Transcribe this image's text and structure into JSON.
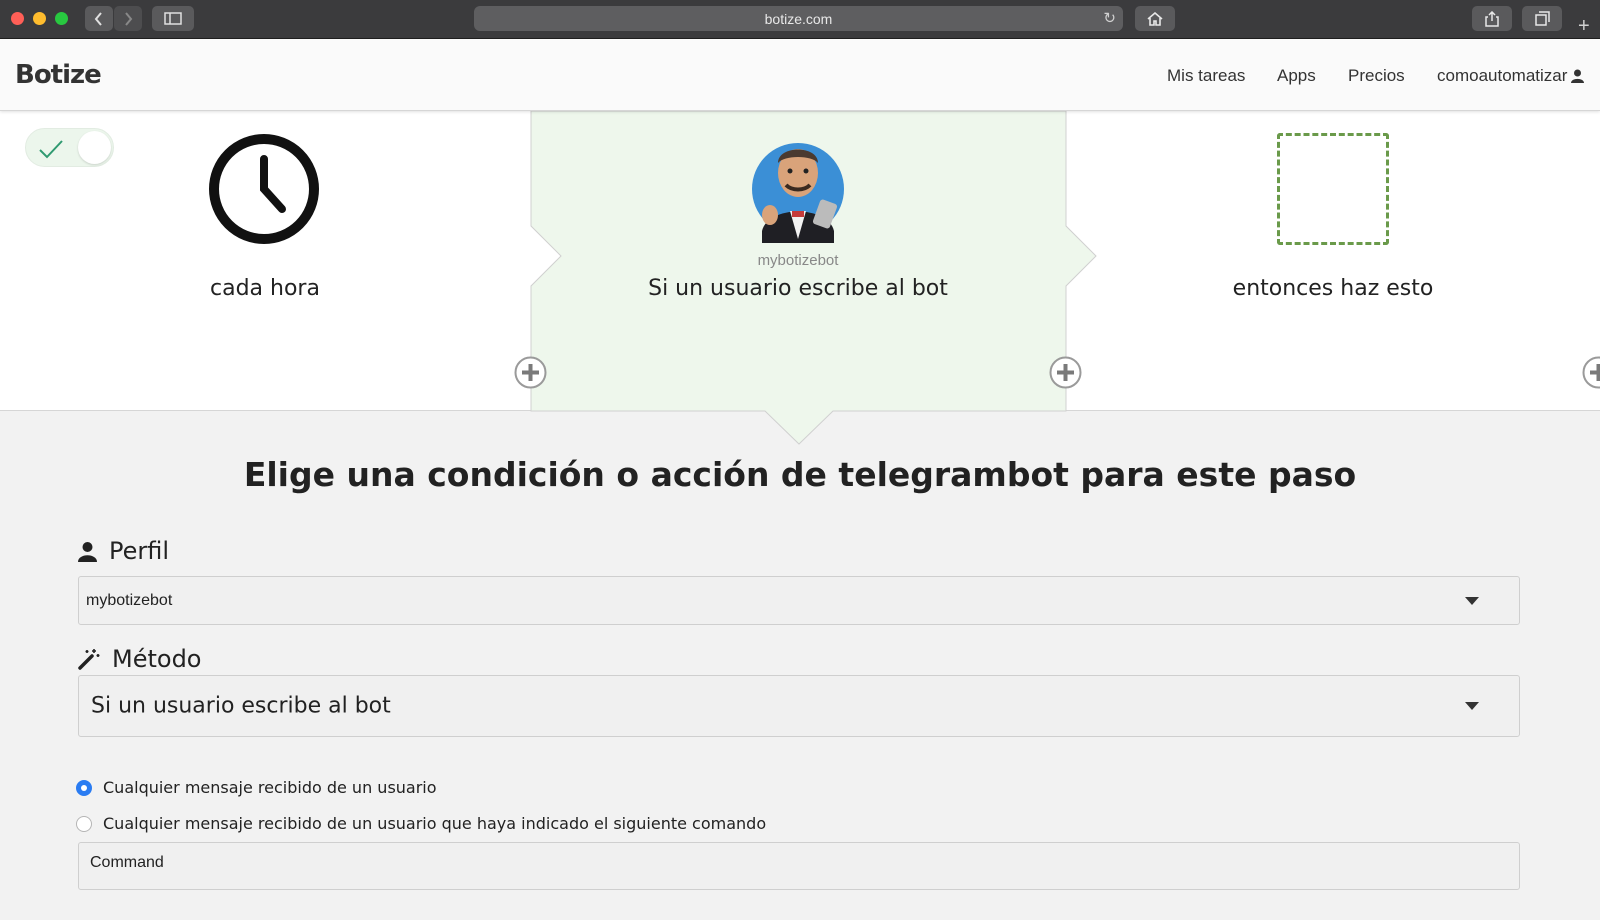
{
  "browser": {
    "url": "botize.com"
  },
  "nav": {
    "logo": "Botize",
    "links": [
      "Mis tareas",
      "Apps",
      "Precios",
      "comoautomatizar"
    ]
  },
  "workflow": {
    "active": true,
    "steps": [
      {
        "caption": "cada hora",
        "icon": "clock-icon"
      },
      {
        "sub": "mybotizebot",
        "caption": "Si un usuario escribe al bot",
        "icon": "bot-avatar"
      },
      {
        "caption": "entonces haz esto",
        "icon": "empty-step-placeholder"
      }
    ]
  },
  "form": {
    "heading_pre": "Elige una ",
    "heading_bold": "condición o acción",
    "heading_post": " de telegrambot para este paso",
    "profile_label": "Perfil",
    "profile_value": "mybotizebot",
    "method_label": "Método",
    "method_value": "Si un usuario escribe al bot",
    "options": [
      "Cualquier mensaje recibido de un usuario",
      "Cualquier mensaje recibido de un usuario que haya indicado el siguiente comando"
    ],
    "selected_option": 0,
    "command_placeholder": "Command"
  },
  "colors": {
    "active_step_bg": "#eef7ec",
    "placeholder_border": "#6a9a4a",
    "radio_selected": "#2a7cf2"
  }
}
